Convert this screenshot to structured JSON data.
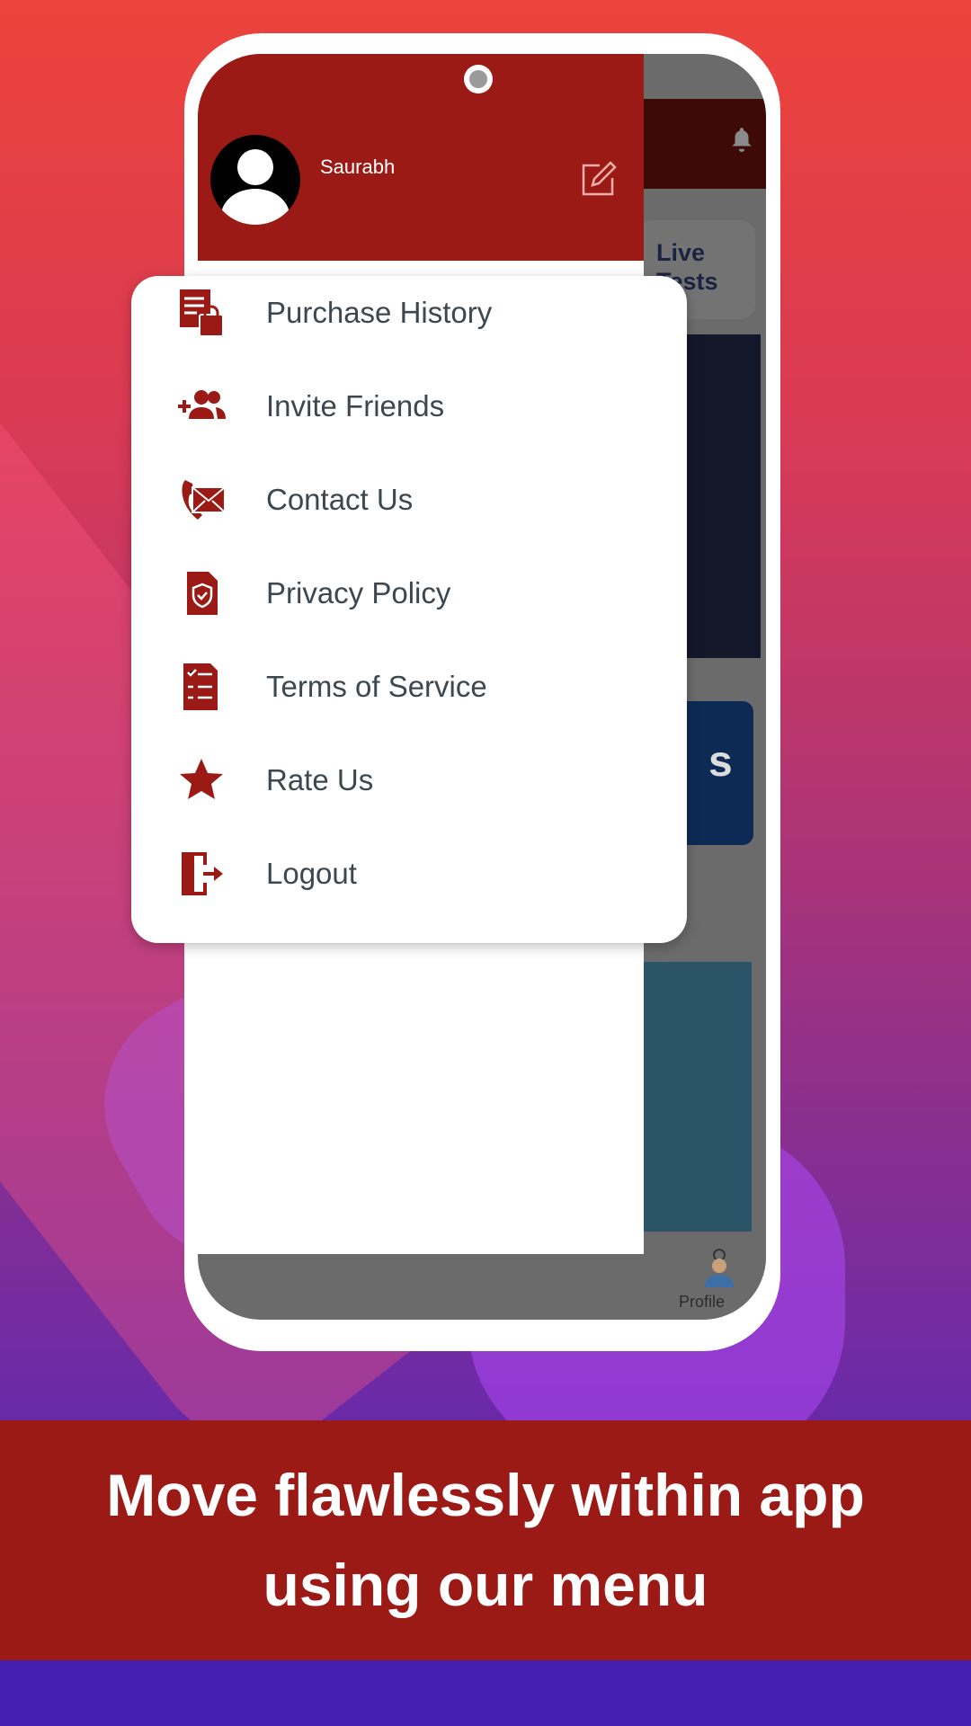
{
  "drawer": {
    "username": "Saurabh",
    "items": [
      {
        "label": "Purchase History",
        "icon": "purchase-history-icon"
      },
      {
        "label": "Invite Friends",
        "icon": "invite-friends-icon"
      },
      {
        "label": "Contact Us",
        "icon": "contact-icon"
      },
      {
        "label": "Privacy Policy",
        "icon": "privacy-shield-icon"
      },
      {
        "label": "Terms of Service",
        "icon": "terms-document-icon"
      },
      {
        "label": "Rate Us",
        "icon": "star-icon"
      },
      {
        "label": "Logout",
        "icon": "logout-icon"
      }
    ]
  },
  "background_app": {
    "live_tests_label": "Live Tests",
    "banner_partial_text": "s",
    "nav_profile_label": "Profile"
  },
  "caption": {
    "line1": "Move flawlessly within app",
    "line2": "using our menu"
  },
  "colors": {
    "brand": "#9b1a15",
    "strip": "#4320b0",
    "text": "#3c4750"
  }
}
